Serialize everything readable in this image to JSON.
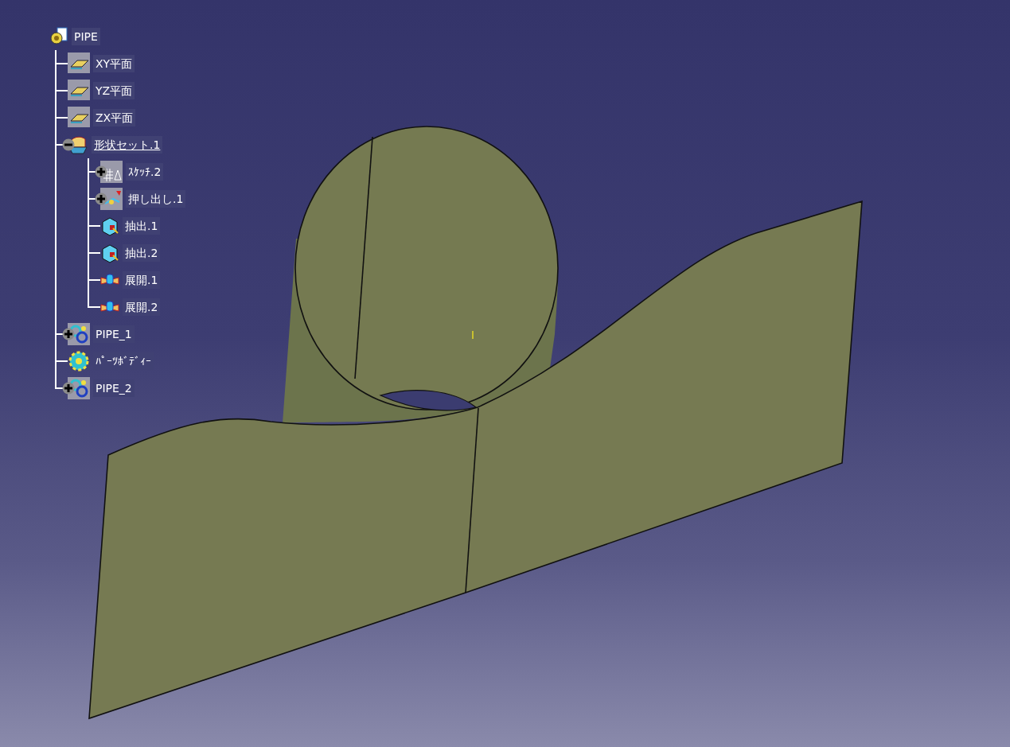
{
  "tree": {
    "label": "PIPE",
    "kind": "part",
    "in_work": false,
    "children": [
      {
        "label": "XY平面",
        "kind": "plane",
        "in_work": false
      },
      {
        "label": "YZ平面",
        "kind": "plane",
        "in_work": false
      },
      {
        "label": "ZX平面",
        "kind": "plane",
        "in_work": false
      },
      {
        "label": "形状セット.1",
        "kind": "geometrical-set",
        "in_work": true,
        "expanded": true,
        "children": [
          {
            "label": "ｽｹｯﾁ.2",
            "kind": "sketch",
            "in_work": false,
            "expanded": false
          },
          {
            "label": "押し出し.1",
            "kind": "extrude",
            "in_work": false,
            "expanded": false
          },
          {
            "label": "抽出.1",
            "kind": "extract",
            "in_work": false
          },
          {
            "label": "抽出.2",
            "kind": "extract",
            "in_work": false
          },
          {
            "label": "展開.1",
            "kind": "unfold",
            "in_work": false
          },
          {
            "label": "展開.2",
            "kind": "unfold",
            "in_work": false
          }
        ]
      },
      {
        "label": "PIPE_1",
        "kind": "body",
        "in_work": false,
        "expanded": false
      },
      {
        "label": "ﾊﾟｰﾂﾎﾞﾃﾞｨｰ",
        "kind": "part-body",
        "in_work": false
      },
      {
        "label": "PIPE_2",
        "kind": "body",
        "in_work": false,
        "expanded": false
      }
    ]
  }
}
